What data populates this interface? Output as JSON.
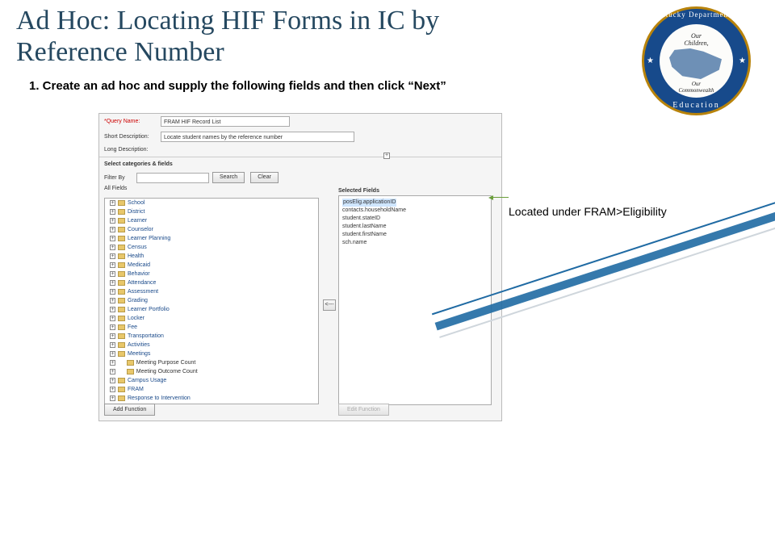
{
  "title": "Ad Hoc: Locating HIF Forms in IC by Reference Number",
  "step1": "1. Create an ad hoc and supply the following fields and  then click “Next”",
  "callout": "Located under FRAM>Eligibility",
  "logo": {
    "arc_top": "Kentucky Department of",
    "arc_bot": "Education",
    "line1": "Our",
    "line2": "Children,",
    "line3": "Our",
    "line4": "Commonwealth"
  },
  "form": {
    "query_label": "*Query Name:",
    "query_value": "FRAM HIF Record List",
    "short_label": "Short Description:",
    "short_value": "Locate student names by the reference number",
    "long_label": "Long Description:",
    "section": "Select categories & fields",
    "filter_label": "Filter By",
    "search_btn": "Search",
    "clear_btn": "Clear",
    "all_fields": "All Fields",
    "selected_fields": "Selected Fields",
    "move_btn": "<---",
    "add_fn": "Add Function",
    "edit_fn": "Edit Function"
  },
  "tree": [
    "School",
    "District",
    "Learner",
    "Counselor",
    "Learner Planning",
    "Census",
    "Health",
    "Medicaid",
    "Behavior",
    "Attendance",
    "Assessment",
    "Grading",
    "Learner Portfolio",
    "Locker",
    "Fee",
    "Transportation",
    "Activities",
    "Meetings",
    "Meeting Purpose Count",
    "Meeting Outcome Count",
    "Campus Usage",
    "FRAM",
    "Response to Intervention"
  ],
  "tree_black_idx": [
    18,
    19
  ],
  "selected": [
    "posElig.applicationID",
    "contacts.householdName",
    "student.stateID",
    "student.lastName",
    "student.firstName",
    "sch.name"
  ]
}
